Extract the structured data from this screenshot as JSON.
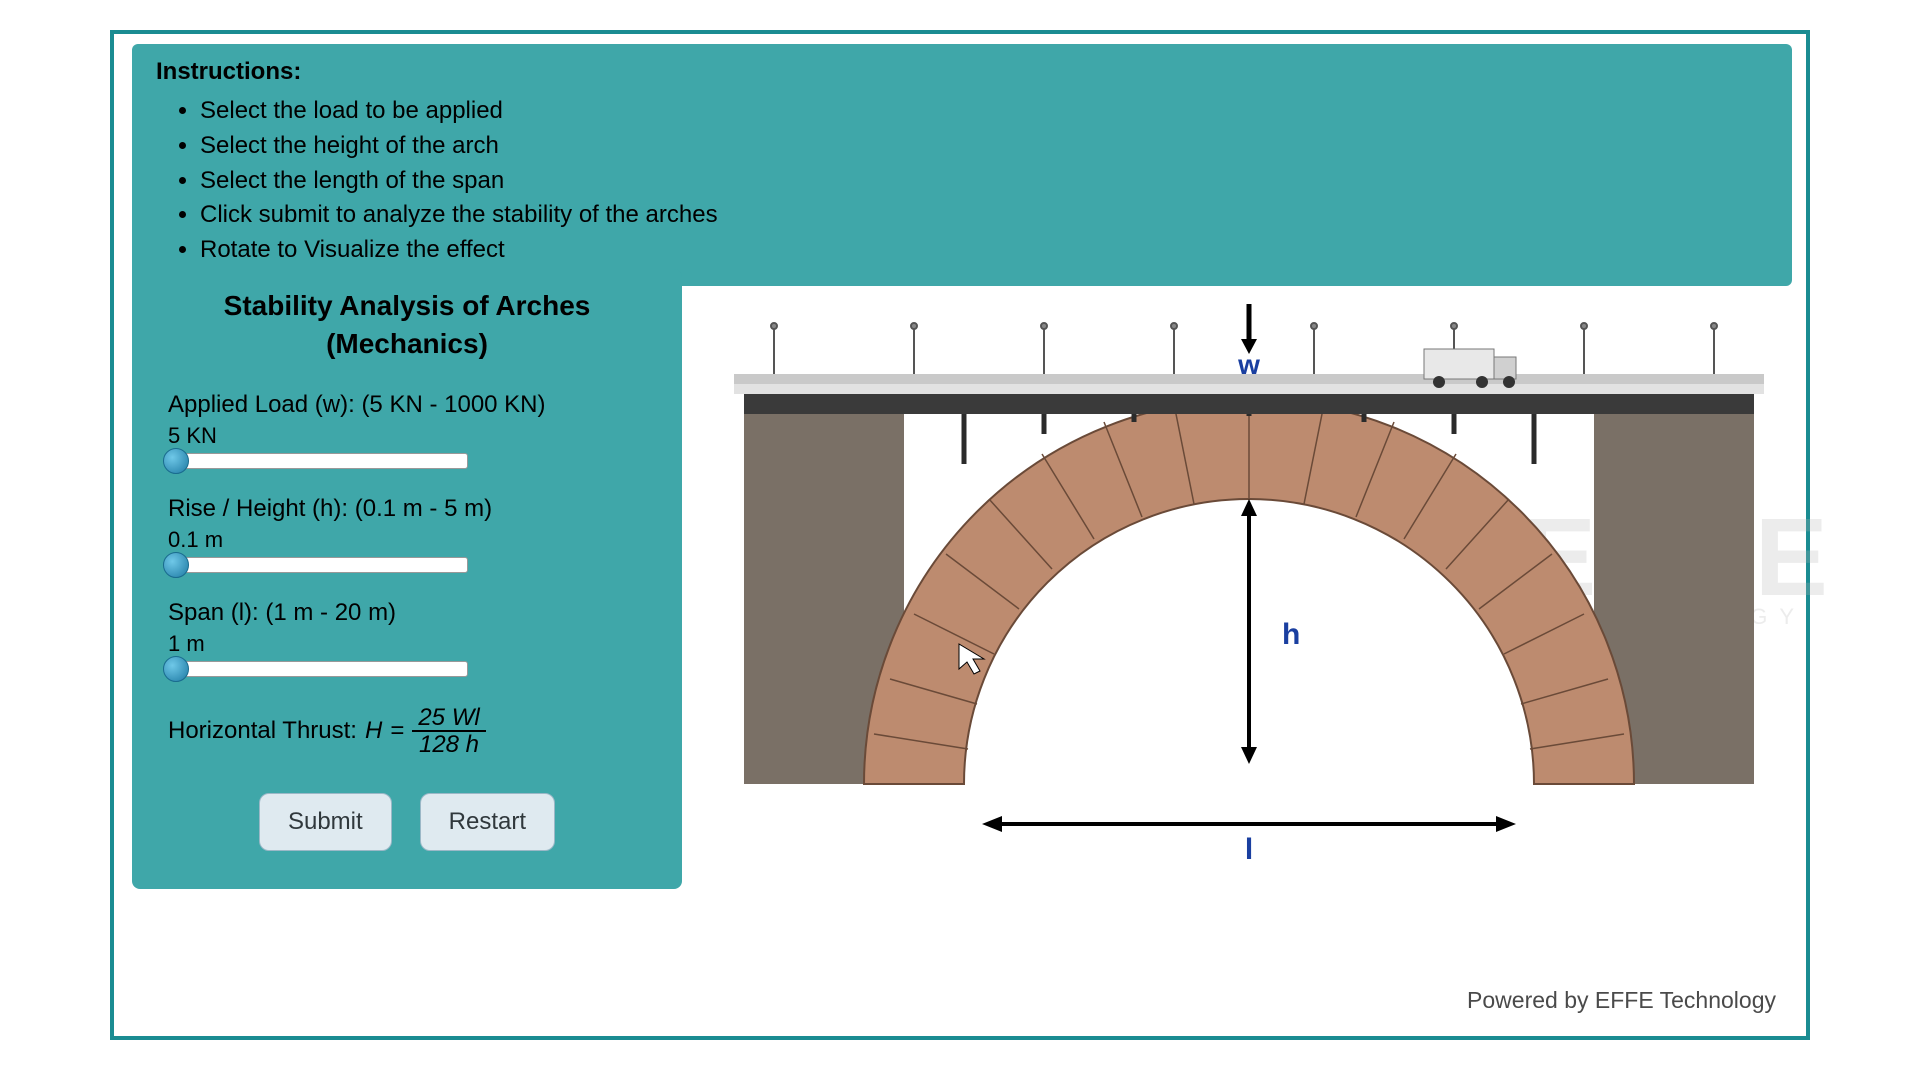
{
  "instructions": {
    "title": "Instructions:",
    "items": [
      "Select the load to be applied",
      "Select the height of the arch",
      "Select the length of the span",
      "Click submit to analyze the stability of the arches",
      "Rotate to Visualize the effect"
    ]
  },
  "panel": {
    "title_line1": "Stability Analysis of Arches",
    "title_line2": "(Mechanics)",
    "load": {
      "label": "Applied Load (w): (5 KN - 1000 KN)",
      "value": "5 KN"
    },
    "rise": {
      "label": "Rise / Height (h): (0.1 m - 5 m)",
      "value": "0.1 m"
    },
    "span": {
      "label": "Span (l): (1 m - 20 m)",
      "value": "1 m"
    },
    "formula": {
      "prefix": "Horizontal Thrust: ",
      "symbol": "H",
      "equals": " = ",
      "numerator": "25 Wl",
      "denominator": "128 h"
    },
    "buttons": {
      "submit": "Submit",
      "restart": "Restart"
    }
  },
  "diagram": {
    "load_label": "w",
    "height_label": "h",
    "span_label": "l"
  },
  "footer": "Powered by EFFE Technology",
  "watermark": {
    "main": "EFFE",
    "sub": "TECHNOLOGY"
  }
}
